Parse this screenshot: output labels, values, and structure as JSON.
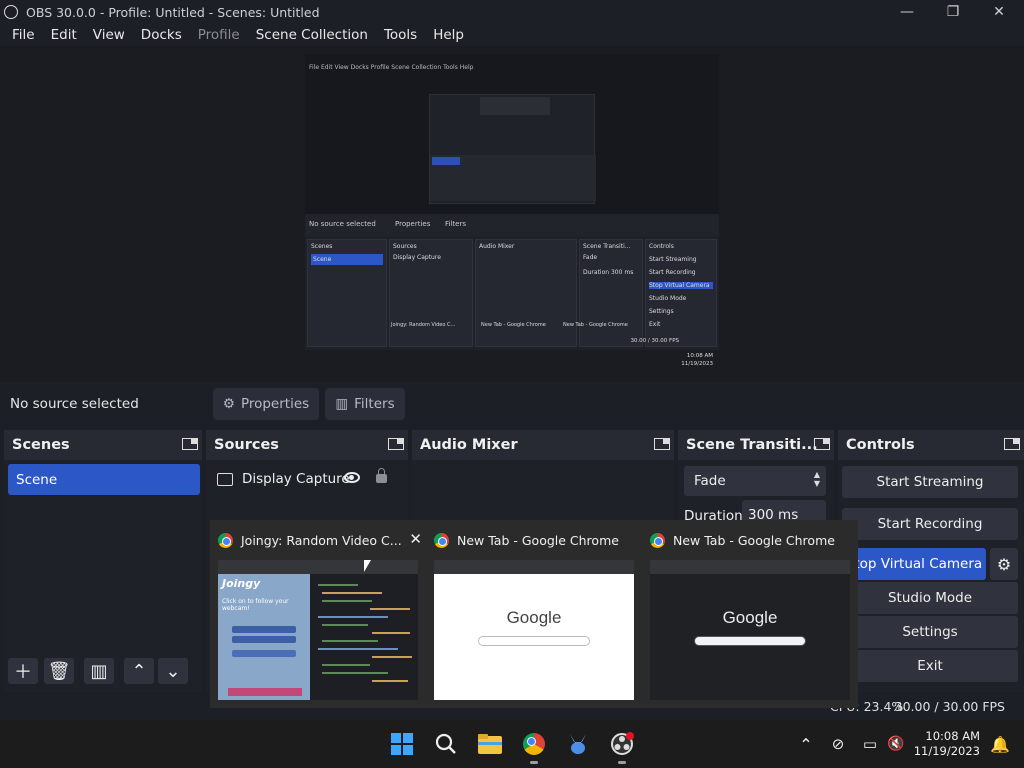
{
  "window": {
    "title": "OBS 30.0.0 - Profile: Untitled - Scenes: Untitled",
    "minimize": "—",
    "maximize": "❐",
    "close": "✕"
  },
  "menu": [
    "File",
    "Edit",
    "View",
    "Docks",
    "Profile",
    "Scene Collection",
    "Tools",
    "Help"
  ],
  "preview_mini": {
    "menu": "File  Edit  View  Docks  Profile  Scene Collection  Tools  Help",
    "no_source": "No source selected",
    "properties": "Properties",
    "filters": "Filters",
    "docks": [
      "Scenes",
      "Sources",
      "Audio Mixer",
      "Scene Transiti...",
      "Controls"
    ],
    "scene": "Scene",
    "source": "Display Capture",
    "fade": "Fade",
    "duration": "Duration",
    "duration_value": "300 ms",
    "controls": [
      "Start Streaming",
      "Start Recording",
      "Stop Virtual Camera",
      "Studio Mode",
      "Settings",
      "Exit"
    ],
    "tabs": [
      "Joingy: Random Video C...",
      "New Tab - Google Chrome",
      "New Tab - Google Chrome"
    ],
    "time": "10:08 AM",
    "date": "11/19/2023",
    "fps": "30.00 / 30.00 FPS"
  },
  "source_toolbar": {
    "status": "No source selected",
    "properties": "Properties",
    "filters": "Filters"
  },
  "scenes": {
    "title": "Scenes",
    "items": [
      "Scene"
    ]
  },
  "sources": {
    "title": "Sources",
    "items": [
      "Display Capture"
    ]
  },
  "audio_mixer": {
    "title": "Audio Mixer"
  },
  "transitions": {
    "title": "Scene Transiti...",
    "selected": "Fade",
    "duration_label": "Duration",
    "duration_value": "300 ms"
  },
  "controls": {
    "title": "Controls",
    "start_streaming": "Start Streaming",
    "start_recording": "Start Recording",
    "stop_virtual_camera": "Stop Virtual Camera",
    "studio_mode": "Studio Mode",
    "settings": "Settings",
    "exit": "Exit"
  },
  "status": {
    "cpu": "CPU: 23.4%",
    "fps": "30.00 / 30.00 FPS"
  },
  "taskbar_previews": [
    {
      "title": "Joingy: Random Video C...",
      "close": "✕"
    },
    {
      "title": "New Tab - Google Chrome"
    },
    {
      "title": "New Tab - Google Chrome"
    }
  ],
  "google_logo": "Google",
  "joingy": {
    "logo": "Joingy",
    "text": "Click on        to follow your webcam!"
  },
  "clock": {
    "time": "10:08 AM",
    "date": "11/19/2023"
  },
  "accent": "#2c57c6"
}
